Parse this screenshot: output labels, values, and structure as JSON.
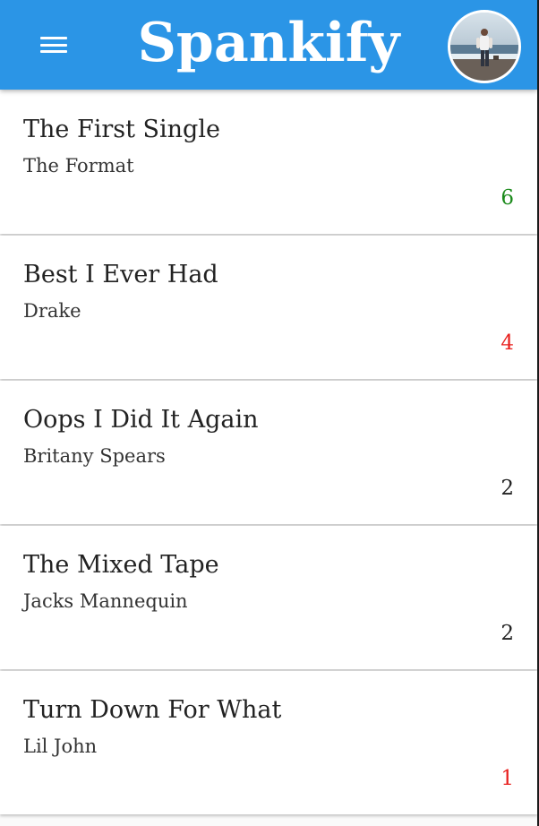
{
  "app": {
    "title": "Spankify"
  },
  "header": {
    "menu_icon": "hamburger-menu-icon",
    "avatar_icon": "user-avatar"
  },
  "colors": {
    "app_bar": "#2b95e6",
    "count_positive": "#1b8a1b",
    "count_negative": "#e8201e",
    "count_neutral": "#222222"
  },
  "songs": [
    {
      "title": "The First Single",
      "artist": "The Format",
      "count": "6",
      "status": "positive"
    },
    {
      "title": "Best I Ever Had",
      "artist": "Drake",
      "count": "4",
      "status": "negative"
    },
    {
      "title": "Oops I Did It Again",
      "artist": "Britany Spears",
      "count": "2",
      "status": "neutral"
    },
    {
      "title": "The Mixed Tape",
      "artist": "Jacks Mannequin",
      "count": "2",
      "status": "neutral"
    },
    {
      "title": "Turn Down For What",
      "artist": "Lil John",
      "count": "1",
      "status": "negative"
    }
  ]
}
